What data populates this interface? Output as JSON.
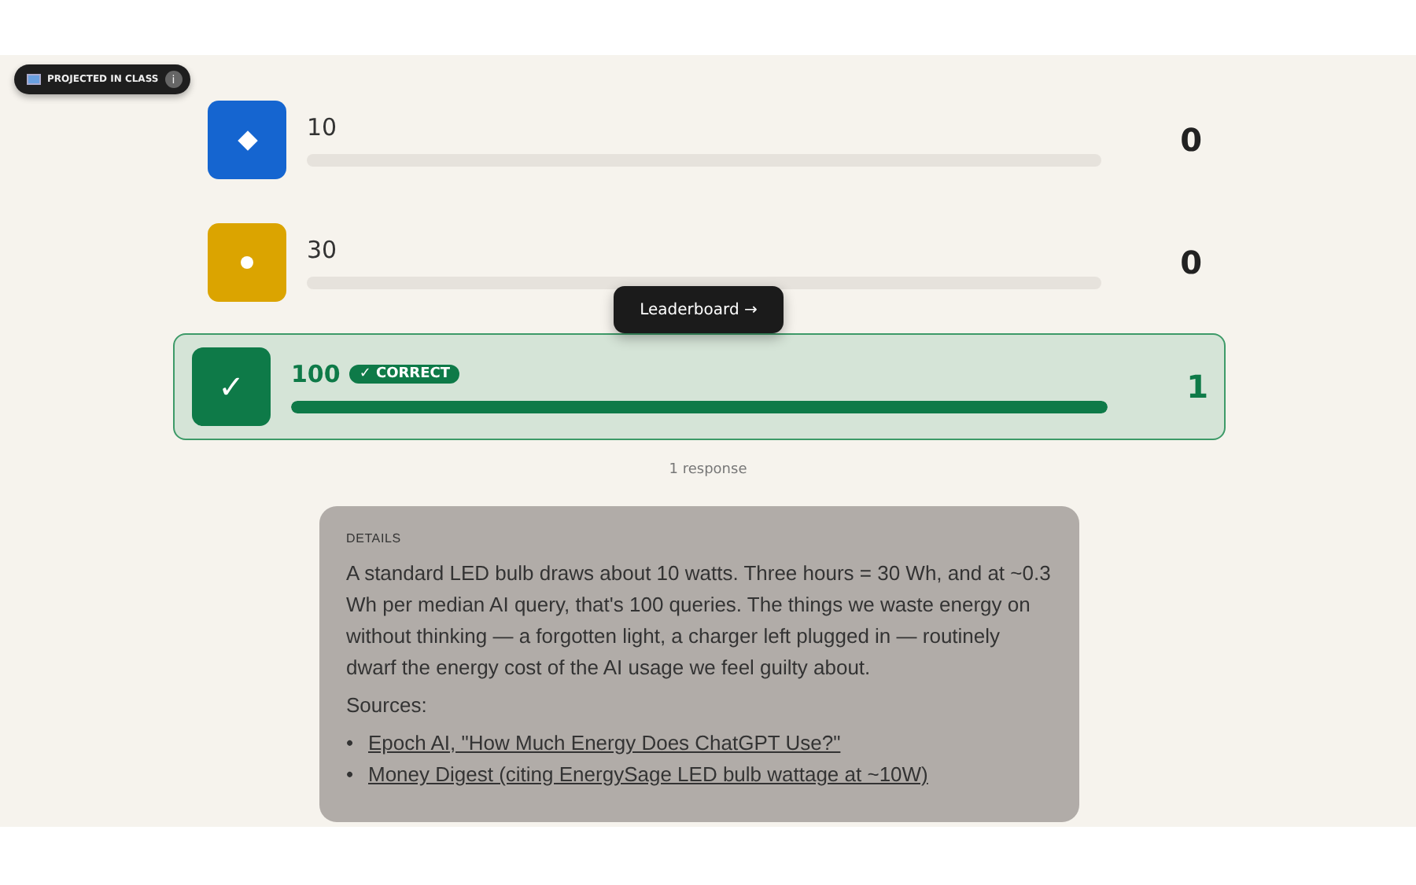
{
  "badge": {
    "label": "PROJECTED IN CLASS",
    "info": "i"
  },
  "options": [
    {
      "kind": "diamond",
      "color": "#1565d0",
      "label": "10",
      "level": 0,
      "count": "0",
      "correct": false
    },
    {
      "kind": "circle",
      "color": "#dba400",
      "label": "30",
      "level": 0,
      "count": "0",
      "correct": false
    },
    {
      "kind": "check",
      "color": "#0e7a48",
      "label": "100",
      "level": 1,
      "count": "1",
      "correct": true,
      "tag": "✓ CORRECT",
      "symbol": "✓"
    }
  ],
  "leaderboard_button": "Leaderboard →",
  "responses": "1 response",
  "details": {
    "heading": "DETAILS",
    "text": "A standard LED bulb draws about 10 watts. Three hours = 30 Wh, and at ~0.3 Wh per median AI query, that's 100 queries. The things we waste energy on without thinking — a forgotten light, a charger left plugged in — routinely dwarf the energy cost of the AI usage we feel guilty about.",
    "sources_label": "Sources:",
    "marker": "•",
    "sources": [
      "Epoch AI, \"How Much Energy Does ChatGPT Use?\"",
      "Money Digest (citing EnergySage LED bulb wattage at ~10W)"
    ]
  }
}
